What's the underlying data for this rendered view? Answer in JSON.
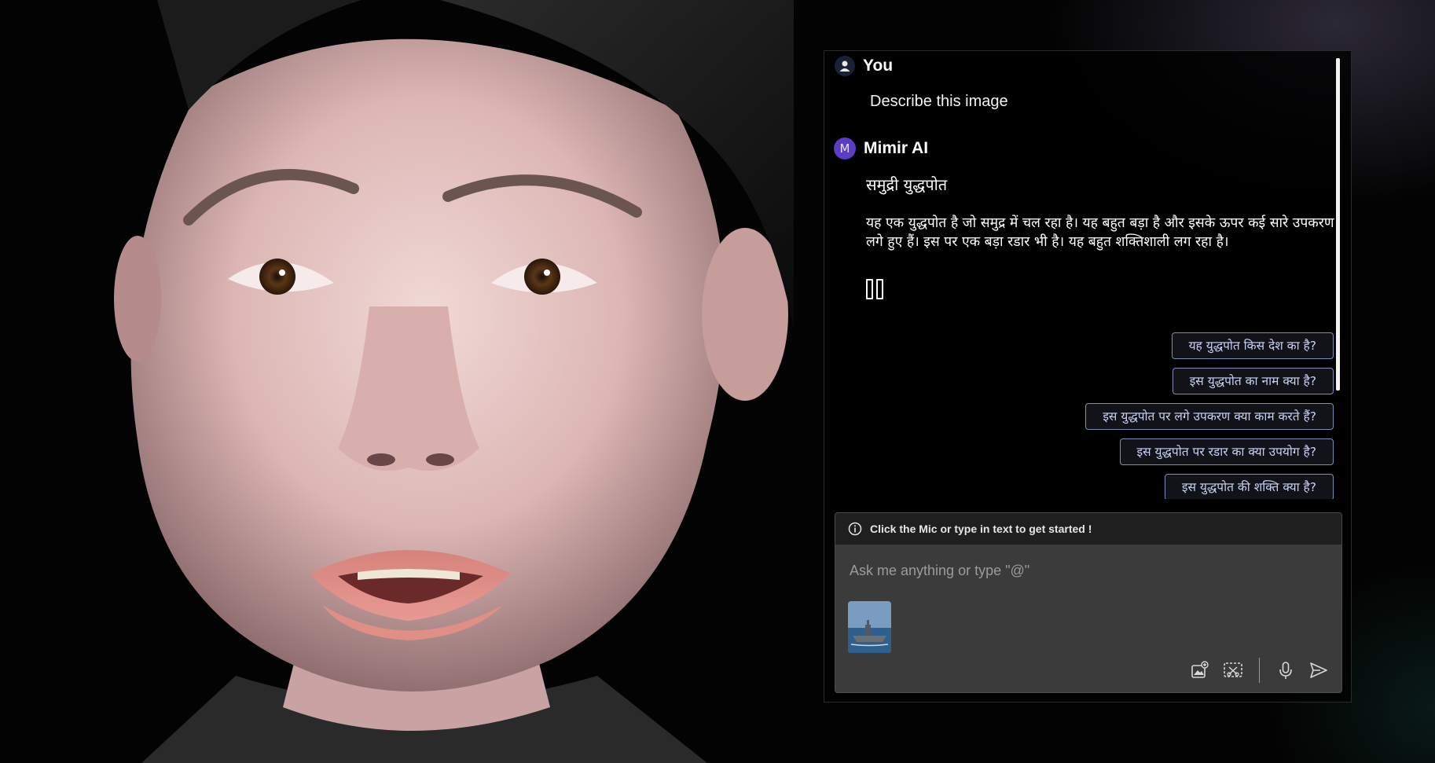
{
  "chat": {
    "user": {
      "name": "You",
      "message": "Describe this image"
    },
    "assistant": {
      "avatar_letter": "M",
      "name": "Mimir AI",
      "title": "समुद्री युद्धपोत",
      "body": "यह एक युद्धपोत है जो समुद्र में चल रहा है। यह बहुत बड़ा है और इसके ऊपर कई सारे उपकरण लगे हुए हैं। इस पर एक बड़ा रडार भी है। यह बहुत शक्तिशाली लग रहा है।",
      "playback_icon": "pause-icon"
    },
    "suggestions": [
      "यह युद्धपोत किस देश का है?",
      "इस युद्धपोत का नाम क्या है?",
      "इस युद्धपोत पर लगे उपकरण क्या काम करते हैं?",
      "इस युद्धपोत पर रडार का क्या उपयोग है?",
      "इस युद्धपोत की शक्ति क्या है?"
    ]
  },
  "composer": {
    "hint": "Click the Mic or type in text to get started !",
    "placeholder": "Ask me anything or type \"@\"",
    "value": "",
    "attachment": "warship thumbnail",
    "tools": [
      "add-image-icon",
      "screen-capture-icon",
      "mic-icon",
      "send-icon"
    ]
  },
  "colors": {
    "assistant_avatar": "#5b3cc4",
    "chip_border": "#7f8bb8",
    "composer_bg": "#3b3b3b"
  }
}
